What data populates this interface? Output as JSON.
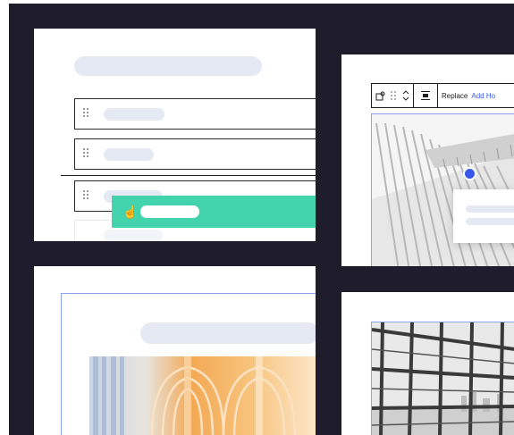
{
  "toolbar": {
    "replace_label": "Replace",
    "add_hotspot_label": "Add Ho"
  },
  "icons": {
    "image_settings": "image-settings-icon",
    "drag": "drag-handle-icon",
    "move": "move-up-down-icon",
    "align": "align-icon",
    "hand": "hand-pointer-icon"
  },
  "colors": {
    "background": "#1f1d2b",
    "accent_green": "#44d4ad",
    "accent_blue": "#3858e9",
    "placeholder": "#e4e9f4"
  }
}
